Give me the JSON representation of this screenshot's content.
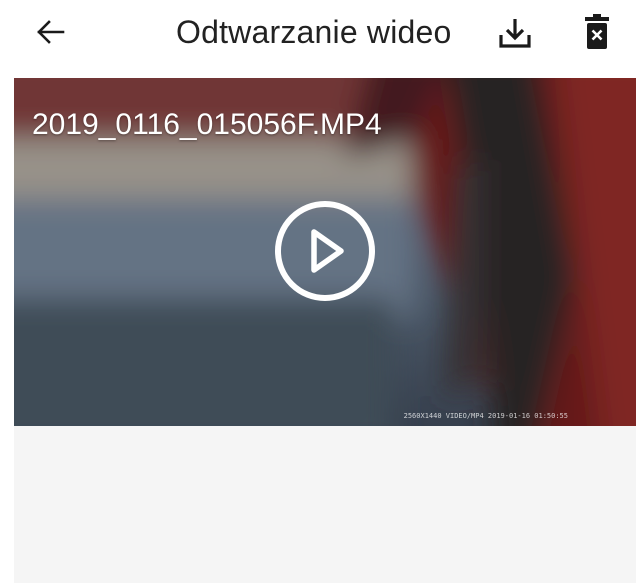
{
  "header": {
    "title": "Odtwarzanie wideo",
    "back_icon": "arrow-left-icon",
    "download_icon": "download-icon",
    "delete_icon": "trash-icon"
  },
  "video": {
    "filename": "2019_0116_015056F.MP4",
    "osd_text": "2560X1440  VIDEO/MP4  2019-01-16 01:50:55",
    "play_icon": "play-circle-icon"
  },
  "colors": {
    "title_text": "#222222",
    "icon": "#1a1a1a",
    "panel_background": "#f5f5f5"
  }
}
